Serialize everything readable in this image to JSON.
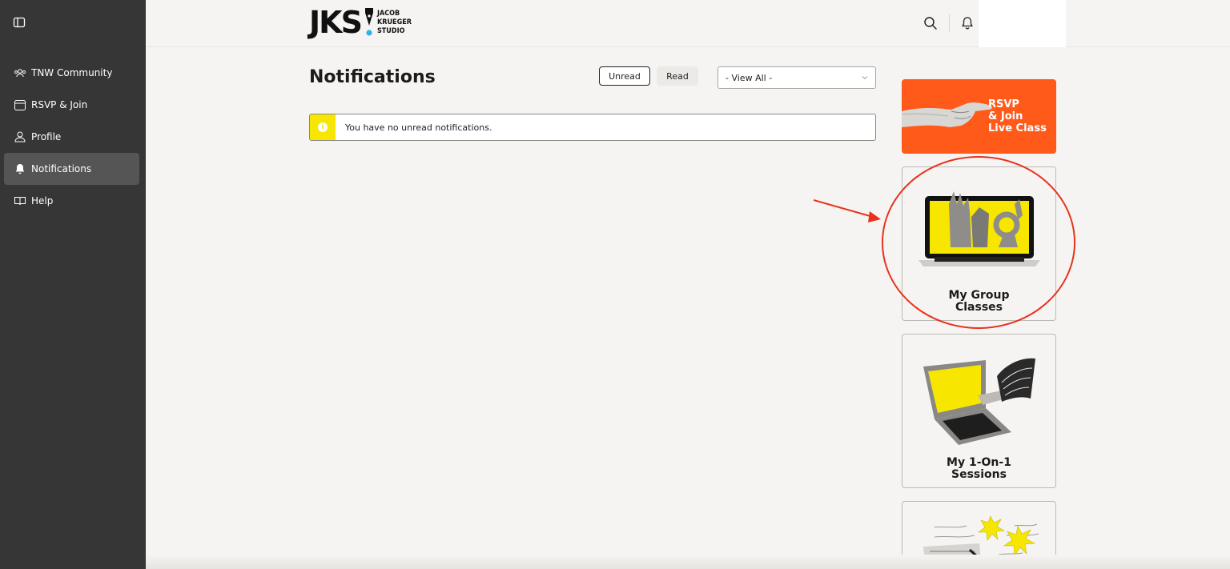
{
  "sidebar": {
    "items": [
      {
        "label": "TNW Community",
        "icon": "community-icon",
        "active": false
      },
      {
        "label": "RSVP & Join",
        "icon": "calendar-icon",
        "active": false
      },
      {
        "label": "Profile",
        "icon": "user-icon",
        "active": false
      },
      {
        "label": "Notifications",
        "icon": "bell-icon",
        "active": true
      },
      {
        "label": "Help",
        "icon": "book-icon",
        "active": false
      }
    ]
  },
  "header": {
    "logo": {
      "mark": "JKS",
      "line1": "JACOB",
      "line2": "KRUEGER",
      "line3": "STUDIO"
    }
  },
  "main": {
    "title": "Notifications",
    "filters": {
      "unread": "Unread",
      "read": "Read"
    },
    "view_select": "- View All -",
    "notice": "You have no unread notifications."
  },
  "cards": {
    "rsvp": {
      "line1": "RSVP",
      "line2": "& Join",
      "line3": "Live Class"
    },
    "group": {
      "line1": "My Group",
      "line2": "Classes"
    },
    "one_on_one": {
      "line1": "My 1-On-1",
      "line2": "Sessions"
    }
  },
  "colors": {
    "sidebar_bg": "#363636",
    "accent_orange": "#ff5a1a",
    "accent_yellow": "#f6e600",
    "annotation_red": "#e8321e"
  }
}
